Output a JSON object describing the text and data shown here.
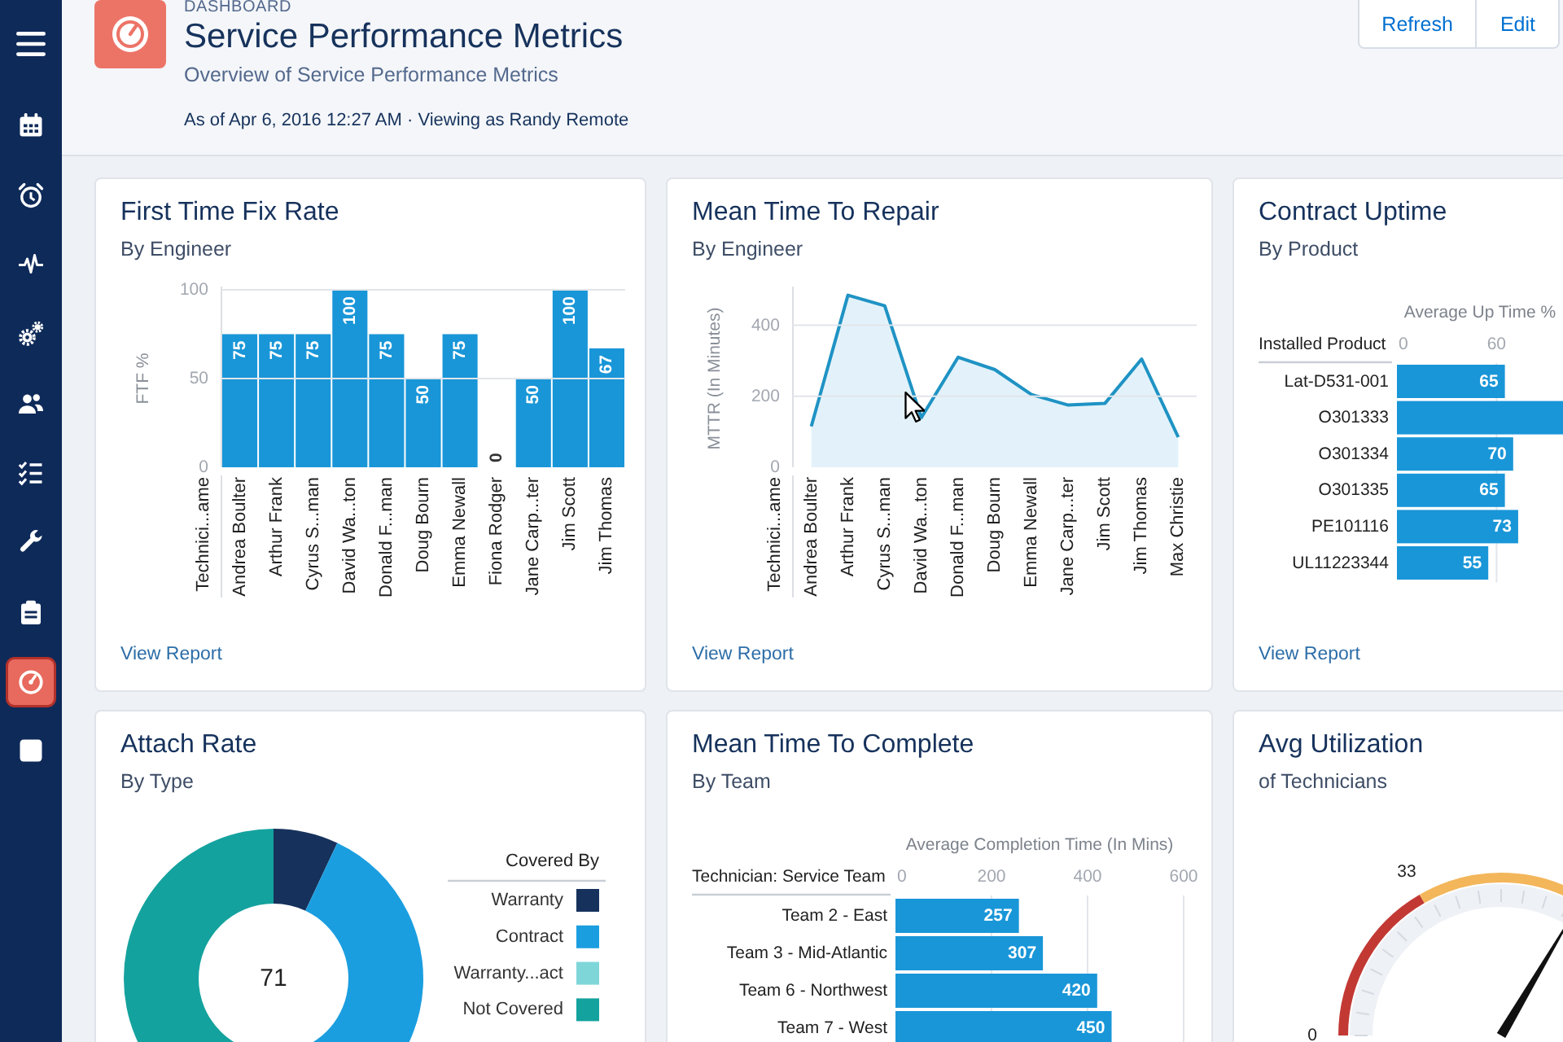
{
  "sidebar": {
    "items": [
      {
        "selected": false
      },
      {
        "selected": false
      },
      {
        "selected": false
      },
      {
        "selected": false
      },
      {
        "selected": false
      },
      {
        "selected": false
      },
      {
        "selected": false
      },
      {
        "selected": false
      },
      {
        "selected": true
      },
      {
        "selected": false
      }
    ]
  },
  "header": {
    "app_label": "DASHBOARD",
    "title": "Service Performance Metrics",
    "subtitle": "Overview of Service Performance Metrics",
    "meta": "As of Apr 6, 2016 12:27 AM · Viewing as Randy Remote",
    "buttons": [
      {
        "label": "Refresh"
      },
      {
        "label": "Edit"
      }
    ]
  },
  "cards": [
    {
      "kind": "chart",
      "title": "First Time Fix Rate",
      "subtitle": "By Engineer",
      "link": "View Report",
      "category_header": "Technici...ame",
      "chart_data": {
        "type": "bar",
        "ylabel": "FTF %",
        "categories": [
          "Andrea Boulter",
          "Arthur Frank",
          "Cyrus S...man",
          "David Wa...ton",
          "Donald F...man",
          "Doug Bourn",
          "Emma Newall",
          "Fiona Rodger",
          "Jane Carp...ter",
          "Jim Scott",
          "Jim Thomas"
        ],
        "values": [
          75,
          75,
          75,
          100,
          75,
          50,
          75,
          0,
          50,
          100,
          67
        ],
        "ylim": [
          0,
          100
        ],
        "yticks": [
          0,
          50,
          100
        ],
        "data_labels": true
      }
    },
    {
      "kind": "chart",
      "title": "Mean Time To Repair",
      "subtitle": "By Engineer",
      "link": "View Report",
      "category_header": "Technici...ame",
      "chart_data": {
        "type": "area",
        "ylabel": "MTTR (In Minutes)",
        "categories": [
          "Andrea Boulter",
          "Arthur Frank",
          "Cyrus S...man",
          "David Wa...ton",
          "Donald F...man",
          "Doug Bourn",
          "Emma Newall",
          "Jane Carp...ter",
          "Jim Scott",
          "Jim Thomas",
          "Max Christie"
        ],
        "values": [
          115,
          485,
          455,
          140,
          310,
          275,
          205,
          175,
          180,
          305,
          85
        ],
        "ylim": [
          0,
          500
        ],
        "yticks": [
          0,
          200,
          400
        ]
      }
    },
    {
      "kind": "chart",
      "title": "Contract Uptime",
      "subtitle": "By Product",
      "link": "View Report",
      "chart_data": {
        "type": "bar",
        "orientation": "horizontal",
        "xlabel": "Average Up Time %",
        "ylabel": "Installed Product",
        "categories": [
          "Lat-D531-001",
          "O301333",
          "O301334",
          "O301335",
          "PE101116",
          "UL11223344"
        ],
        "values": [
          65,
          100,
          70,
          65,
          73,
          55
        ],
        "xlim": [
          0,
          100
        ],
        "xticks": [
          0,
          60
        ],
        "value_labels": [
          "65",
          null,
          "70",
          "65",
          "73",
          "55"
        ]
      }
    },
    {
      "kind": "donut",
      "title": "Attach Rate",
      "subtitle": "By Type",
      "center_value": "71",
      "legend": {
        "title": "Covered By",
        "items": [
          {
            "label": "Warranty",
            "color": "#16325c"
          },
          {
            "label": "Contract",
            "color": "#1b9ee0"
          },
          {
            "label": "Warranty...act",
            "color": "#7ed6d9"
          },
          {
            "label": "Not Covered",
            "color": "#14a29e"
          }
        ]
      }
    },
    {
      "kind": "chart",
      "title": "Mean Time To Complete",
      "subtitle": "By Team",
      "chart_data": {
        "type": "bar",
        "orientation": "horizontal",
        "xlabel": "Average Completion Time (In Mins)",
        "ylabel": "Technician: Service Team",
        "categories": [
          "Team 2 - East",
          "Team 3 - Mid-Atlantic",
          "Team 6 - Northwest",
          "Team 7 - West"
        ],
        "values": [
          257,
          307,
          420,
          450
        ],
        "xlim": [
          0,
          600
        ],
        "xticks": [
          0,
          200,
          400,
          600
        ],
        "data_labels": true
      }
    },
    {
      "kind": "gauge",
      "title": "Avg Utilization",
      "subtitle": "of Technicians",
      "gauge": {
        "level": 0.67,
        "labels": [
          "0",
          "33"
        ]
      }
    }
  ]
}
